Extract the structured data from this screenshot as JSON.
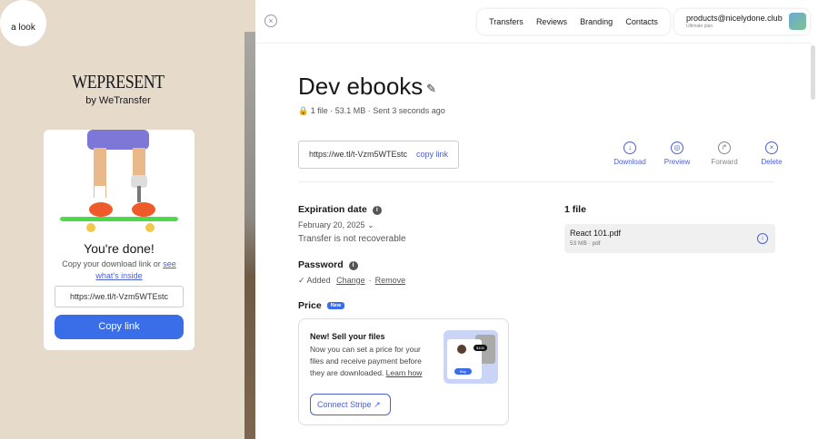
{
  "left": {
    "badge": "a look",
    "logo": "WEPRESENT",
    "logo_sub": "by WeTransfer",
    "done_title": "You're done!",
    "copy_text": "Copy your download link or ",
    "see_link": "see what's inside",
    "link_value": "https://we.tl/t-Vzm5WTEstc",
    "copy_button": "Copy link"
  },
  "nav": {
    "items": [
      "Transfers",
      "Reviews",
      "Branding",
      "Contacts"
    ],
    "email": "products@nicelydone.club",
    "plan": "Ultimate plan"
  },
  "transfer": {
    "title": "Dev ebooks",
    "meta": "🔒 1 file · 53.1 MB · Sent 3 seconds ago",
    "link": "https://we.tl/t-Vzm5WTEstc",
    "copy_link": "copy link",
    "actions": [
      {
        "label": "Download",
        "icon": "↓"
      },
      {
        "label": "Preview",
        "icon": "◎"
      },
      {
        "label": "Forward",
        "icon": "↱"
      },
      {
        "label": "Delete",
        "icon": "×"
      }
    ],
    "expiration_label": "Expiration date",
    "expiration_date": "February 20, 2025",
    "not_recoverable": "Transfer is not recoverable",
    "password_label": "Password",
    "password_status": "✓ Added",
    "change": "Change",
    "remove": "Remove",
    "price_label": "Price",
    "new_badge": "New",
    "promo": {
      "heading": "New! Sell your files",
      "text": "Now you can set a price for your files and receive payment before they are downloaded. ",
      "learn": "Learn how",
      "button": "Connect Stripe",
      "price_tag": "$100",
      "buy": "Buy"
    },
    "files_heading": "1 file",
    "file": {
      "name": "React 101.pdf",
      "info": "53 MB · pdf"
    }
  },
  "colors": {
    "accent": "#3a6ee8",
    "link": "#4b5fd3",
    "background": "#e6dacb"
  }
}
